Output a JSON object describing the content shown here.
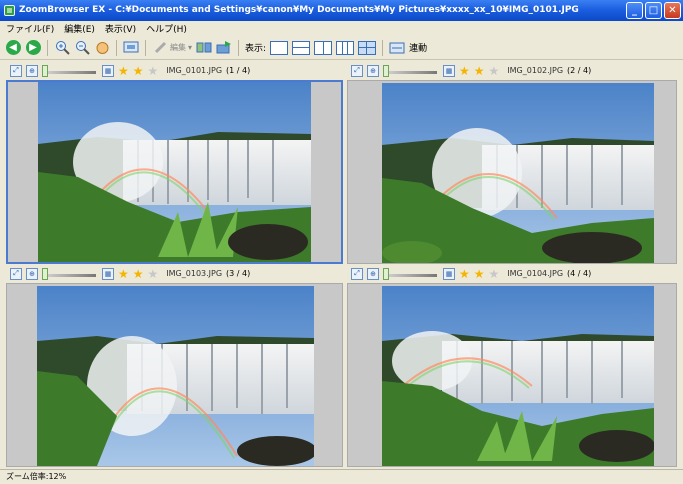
{
  "window": {
    "title": "ZoomBrowser EX - C:¥Documents and Settings¥canon¥My Documents¥My Pictures¥xxxx_xx_10¥IMG_0101.JPG",
    "minimize": "_",
    "maximize": "□",
    "close": "✕"
  },
  "menu": [
    "ファイル(F)",
    "編集(E)",
    "表示(V)",
    "ヘルプ(H)"
  ],
  "toolbar": {
    "edit_label": "編集",
    "display_label": "表示:",
    "link_label": "連動"
  },
  "panels": [
    {
      "filename": "IMG_0101.JPG",
      "position": "(1 / 4)",
      "rating": 2,
      "selected": true
    },
    {
      "filename": "IMG_0102.JPG",
      "position": "(2 / 4)",
      "rating": 2,
      "selected": false
    },
    {
      "filename": "IMG_0103.JPG",
      "position": "(3 / 4)",
      "rating": 2,
      "selected": false
    },
    {
      "filename": "IMG_0104.JPG",
      "position": "(4 / 4)",
      "rating": 2,
      "selected": false
    }
  ],
  "status": {
    "text": "ズーム倍率:12%"
  },
  "colors": {
    "titlebar": "#1c5fe0",
    "sky": "#6d9ed6",
    "grass": "#3d7a2a",
    "water": "#ffffff",
    "selection": "#4a7bd0"
  }
}
